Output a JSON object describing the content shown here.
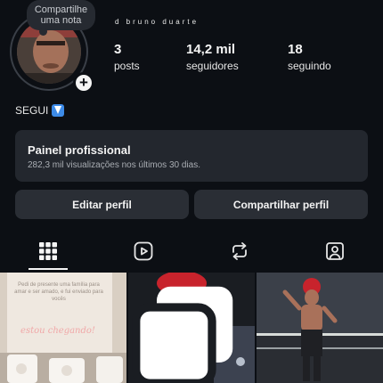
{
  "profile": {
    "note": "Compartilhe uma nota",
    "display_name": "d bruno duarte",
    "bio": "SEGUI"
  },
  "stats": [
    {
      "value": "3",
      "label": "posts"
    },
    {
      "value": "14,2 mil",
      "label": "seguidores"
    },
    {
      "value": "18",
      "label": "seguindo"
    }
  ],
  "pro_panel": {
    "title": "Painel profissional",
    "subtitle": "282,3 mil visualizações nos últimos 30 dias."
  },
  "buttons": {
    "edit": "Editar perfil",
    "share": "Compartilhar perfil"
  },
  "tabs": [
    {
      "icon": "grid-icon",
      "active": true
    },
    {
      "icon": "reels-icon",
      "active": false
    },
    {
      "icon": "reposts-icon",
      "active": false
    },
    {
      "icon": "tagged-icon",
      "active": false
    }
  ],
  "posts": [
    {
      "card_text": "Pedi de presente uma família para amar e ser amado, e fui enviado para vocês",
      "script": "estou chegando!"
    },
    {
      "multi": true
    },
    {
      "multi": false
    }
  ],
  "colors": {
    "background": "#0c0f14",
    "panel": "#23272e",
    "button": "#2a2e35",
    "emoji_blue": "#3d8be8"
  }
}
